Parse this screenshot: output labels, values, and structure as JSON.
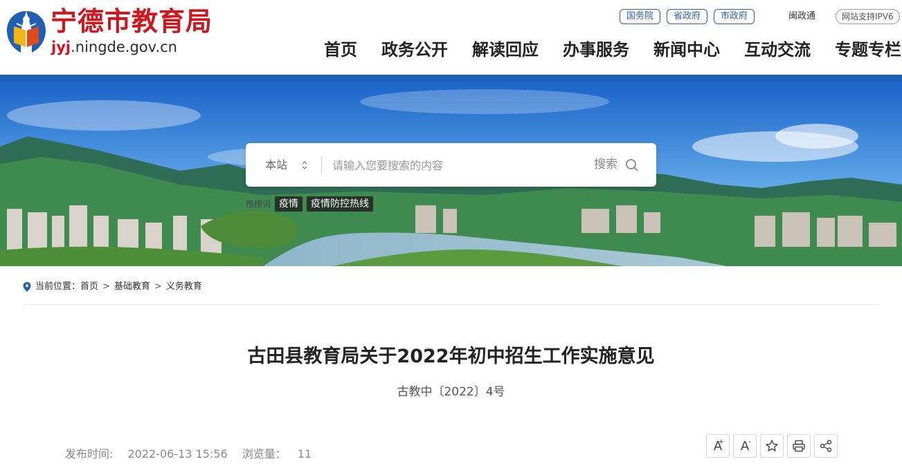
{
  "header": {
    "site_title": "宁德市教育局",
    "domain_accent": "jyj",
    "domain_rest": ".ningde.gov.cn",
    "gov_links": [
      "国务院",
      "省政府",
      "市政府"
    ],
    "min_gov": "闽政通",
    "ipv6": "网站支持IPV6",
    "nav": [
      "首页",
      "政务公开",
      "解读回应",
      "办事服务",
      "新闻中心",
      "互动交流",
      "专题专栏"
    ]
  },
  "search": {
    "scope": "本站",
    "placeholder": "请输入您要搜索的内容",
    "button": "搜索",
    "hot_label": "热搜词",
    "hot_tags": [
      "疫情",
      "疫情防控热线"
    ]
  },
  "breadcrumb": {
    "label": "当前位置：",
    "items": [
      "首页",
      "基础教育",
      "义务教育"
    ]
  },
  "article": {
    "title": "古田县教育局关于2022年初中招生工作实施意见",
    "doc_no": "古教中〔2022〕4号",
    "publish_label": "发布时间:",
    "publish_time": "2022-06-13 15:56",
    "views_label": "浏览量：",
    "views": "11"
  },
  "tools": {
    "font_larger": "A",
    "font_larger_mark": "+",
    "font_smaller": "A",
    "font_smaller_mark": "-"
  },
  "colors": {
    "brand_red": "#d0151c",
    "brand_blue": "#1f5fb4"
  }
}
